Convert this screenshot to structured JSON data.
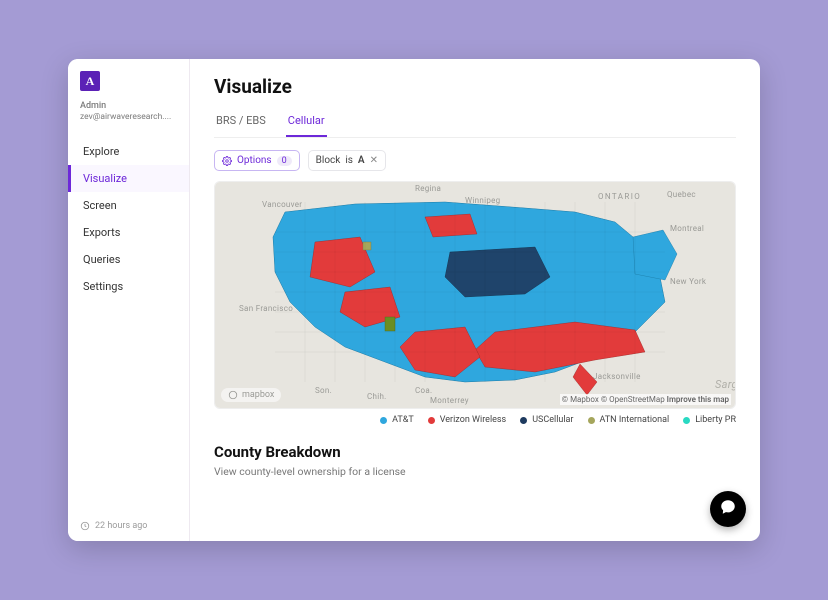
{
  "colors": {
    "accent": "#6d28d9",
    "att": "#2fa7de",
    "verizon": "#e23b3b",
    "usc": "#1e3a5f",
    "atn": "#a5a65c",
    "liberty": "#29d9c2"
  },
  "sidebar": {
    "logo_letter": "A",
    "user_role": "Admin",
    "user_email": "zev@airwaveresearch....",
    "items": [
      {
        "label": "Explore",
        "active": false
      },
      {
        "label": "Visualize",
        "active": true
      },
      {
        "label": "Screen",
        "active": false
      },
      {
        "label": "Exports",
        "active": false
      },
      {
        "label": "Queries",
        "active": false
      },
      {
        "label": "Settings",
        "active": false
      }
    ],
    "footer_time": "22 hours ago"
  },
  "page": {
    "title": "Visualize",
    "tabs": [
      {
        "label": "BRS / EBS",
        "active": false
      },
      {
        "label": "Cellular",
        "active": true
      }
    ],
    "options_label": "Options",
    "options_count": "0",
    "filter": {
      "field": "Block",
      "op": "is",
      "value": "A"
    }
  },
  "map": {
    "badge": "mapbox",
    "attrib_mapbox": "© Mapbox",
    "attrib_osm": "© OpenStreetMap",
    "attrib_improve": "Improve this map",
    "labels": {
      "vancouver": "Vancouver",
      "regina": "Regina",
      "winnipeg": "Winnipeg",
      "ontario": "ONTARIO",
      "quebec": "Quebec",
      "montreal": "Montreal",
      "newyork": "New York",
      "sanfran": "San Francisco",
      "jacksonville": "Jacksonville",
      "monterrey": "Monterrey",
      "chih": "Chih.",
      "son": "Son.",
      "coa": "Coa.",
      "sarg": "Sarg"
    }
  },
  "legend": [
    {
      "key": "att",
      "label": "AT&T"
    },
    {
      "key": "verizon",
      "label": "Verizon Wireless"
    },
    {
      "key": "usc",
      "label": "USCellular"
    },
    {
      "key": "atn",
      "label": "ATN International"
    },
    {
      "key": "liberty",
      "label": "Liberty PR"
    }
  ],
  "breakdown": {
    "title": "County Breakdown",
    "subtitle": "View county-level ownership for a license"
  }
}
